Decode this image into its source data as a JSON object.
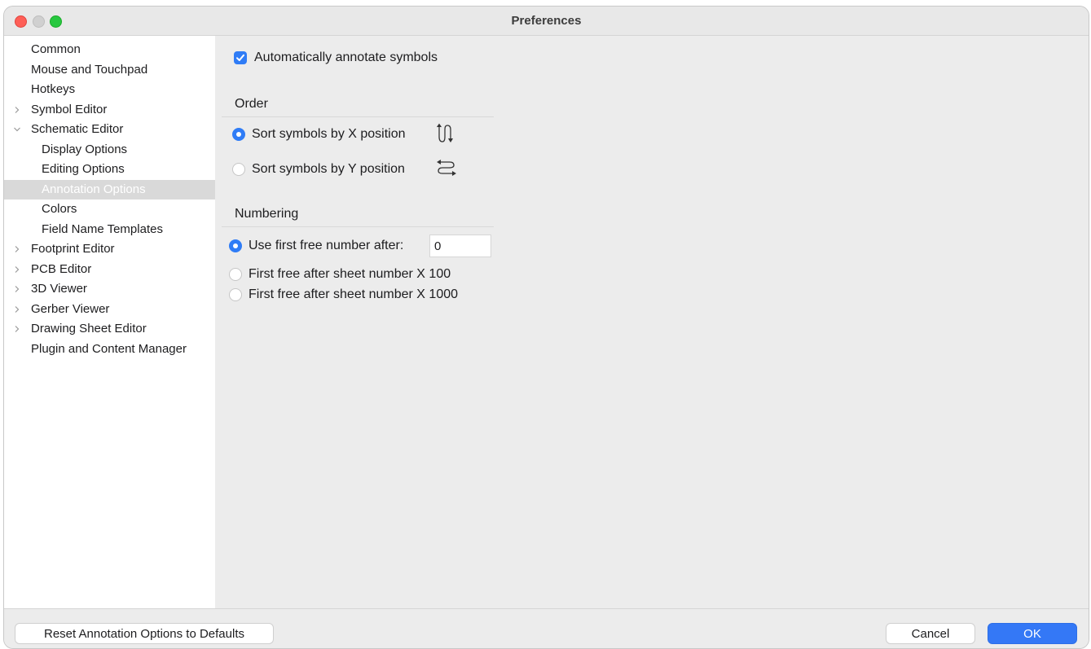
{
  "window": {
    "title": "Preferences"
  },
  "sidebar": {
    "items": [
      {
        "label": "Common",
        "level": 0,
        "expander": "none"
      },
      {
        "label": "Mouse and Touchpad",
        "level": 0,
        "expander": "none"
      },
      {
        "label": "Hotkeys",
        "level": 0,
        "expander": "none"
      },
      {
        "label": "Symbol Editor",
        "level": 0,
        "expander": "collapsed"
      },
      {
        "label": "Schematic Editor",
        "level": 0,
        "expander": "expanded"
      },
      {
        "label": "Display Options",
        "level": 1,
        "expander": "none"
      },
      {
        "label": "Editing Options",
        "level": 1,
        "expander": "none"
      },
      {
        "label": "Annotation Options",
        "level": 1,
        "expander": "none",
        "selected": true
      },
      {
        "label": "Colors",
        "level": 1,
        "expander": "none"
      },
      {
        "label": "Field Name Templates",
        "level": 1,
        "expander": "none"
      },
      {
        "label": "Footprint Editor",
        "level": 0,
        "expander": "collapsed"
      },
      {
        "label": "PCB Editor",
        "level": 0,
        "expander": "collapsed"
      },
      {
        "label": "3D Viewer",
        "level": 0,
        "expander": "collapsed"
      },
      {
        "label": "Gerber Viewer",
        "level": 0,
        "expander": "collapsed"
      },
      {
        "label": "Drawing Sheet Editor",
        "level": 0,
        "expander": "collapsed"
      },
      {
        "label": "Plugin and Content Manager",
        "level": 0,
        "expander": "none"
      }
    ]
  },
  "annotation": {
    "auto_annotate": {
      "label": "Automatically annotate symbols",
      "checked": true
    },
    "order": {
      "title": "Order",
      "options": [
        {
          "label": "Sort symbols by X position",
          "selected": true,
          "icon": "sort-x-arrows-icon"
        },
        {
          "label": "Sort symbols by Y position",
          "selected": false,
          "icon": "sort-y-arrows-icon"
        }
      ]
    },
    "numbering": {
      "title": "Numbering",
      "options": [
        {
          "label": "Use first free number after:",
          "selected": true
        },
        {
          "label": "First free after sheet number X 100",
          "selected": false
        },
        {
          "label": "First free after sheet number X 1000",
          "selected": false
        }
      ],
      "start_value": "0"
    }
  },
  "footer": {
    "reset_label": "Reset Annotation Options to Defaults",
    "cancel_label": "Cancel",
    "ok_label": "OK"
  },
  "colors": {
    "accent": "#2f7cf6",
    "close": "#fe5f57",
    "maximize": "#28c840"
  }
}
